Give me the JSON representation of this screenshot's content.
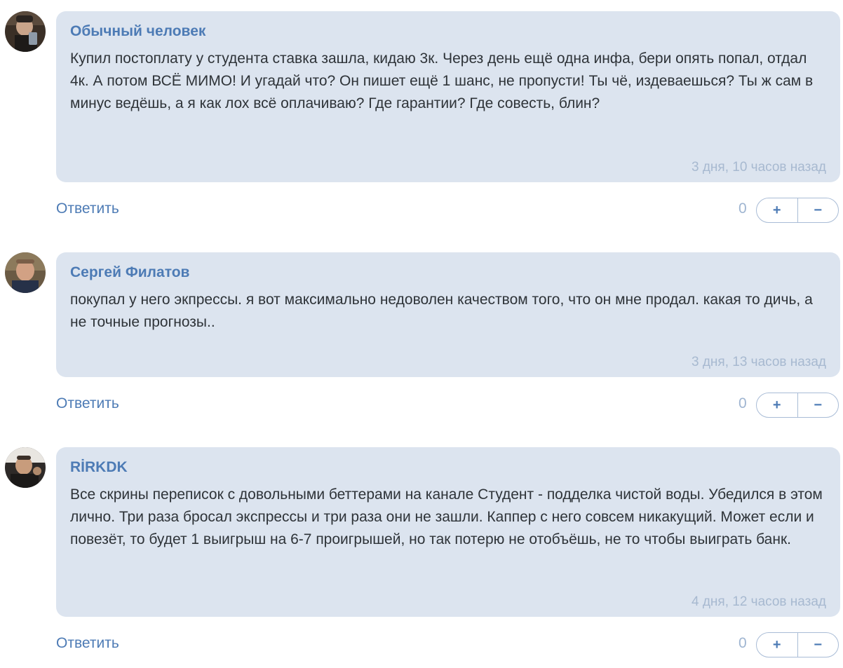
{
  "comments": [
    {
      "author": "Обычный человек",
      "text": "Купил постоплату у студента ставка зашла, кидаю 3к. Через день ещё одна инфа, бери опять попал, отдал 4к. А потом ВСЁ МИМО! И угадай что? Он пишет ещё 1 шанс, не пропусти! Ты чё, издеваешься? Ты ж сам в минус ведёшь, а я как лох всё оплачиваю? Где гарантии? Где совесть, блин?",
      "time": "3 дня, 10 часов назад",
      "reply_label": "Ответить",
      "score": "0",
      "plus_label": "+",
      "minus_label": "−"
    },
    {
      "author": "Сергей Филатов",
      "text": "покупал у него экпрессы. я вот максимально недоволен качеством того, что он мне продал. какая то дичь, а не точные прогнозы..",
      "time": "3 дня, 13 часов назад",
      "reply_label": "Ответить",
      "score": "0",
      "plus_label": "+",
      "minus_label": "−"
    },
    {
      "author": "RİRKDK",
      "text": "Все скрины переписок с довольными беттерами на канале Студент - подделка чистой воды. Убедился в этом лично. Три раза бросал экспрессы и три раза они не зашли. Каппер с него совсем никакущий. Может если и повезёт, то будет 1 выигрыш на 6-7 проигрышей, но так потерю не отобъёшь, не то чтобы выиграть банк.",
      "time": "4 дня, 12 часов назад",
      "reply_label": "Ответить",
      "score": "0",
      "plus_label": "+",
      "minus_label": "−"
    }
  ],
  "colors": {
    "bubble_bg": "#dce4ef",
    "author": "#4d7bb5",
    "text": "#2e3338",
    "time": "#a7b9d0",
    "link": "#4d7bb5"
  },
  "icons": [
    "avatar-photo",
    "avatar-photo",
    "avatar-photo"
  ]
}
